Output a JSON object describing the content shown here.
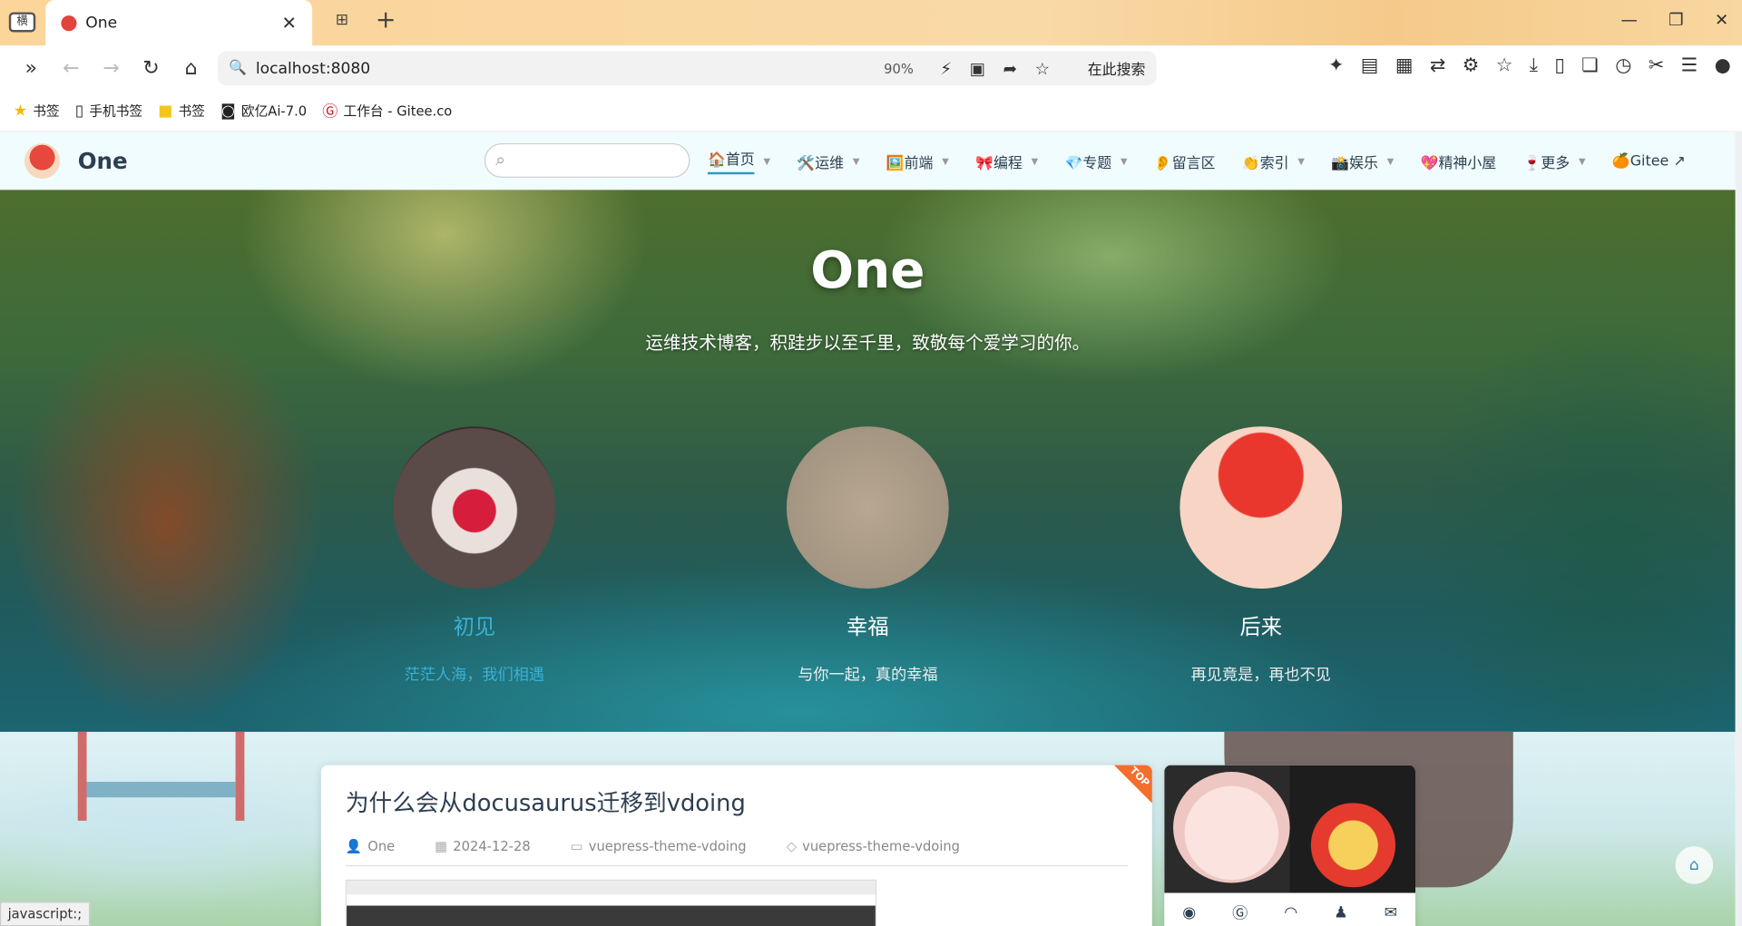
{
  "browser": {
    "tab_side": "横",
    "tab_title": "One",
    "url": "localhost:8080",
    "zoom": "90%",
    "search_placeholder": "在此搜索",
    "bookmarks": [
      {
        "label": "书签",
        "icon": "star-icon"
      },
      {
        "label": "手机书签",
        "icon": "phone-icon"
      },
      {
        "label": "书签",
        "icon": "folder-icon"
      },
      {
        "label": "欧亿Ai-7.0",
        "icon": "bot-icon"
      },
      {
        "label": "工作台 - Gitee.co",
        "icon": "gitee-icon"
      }
    ],
    "status_text": "javascript:;"
  },
  "site": {
    "name": "One",
    "nav": [
      {
        "label": "🏠首页",
        "caret": true,
        "active": true
      },
      {
        "label": "🛠️运维",
        "caret": true
      },
      {
        "label": "🖼️前端",
        "caret": true
      },
      {
        "label": "🎀编程",
        "caret": true
      },
      {
        "label": "💎专题",
        "caret": true
      },
      {
        "label": "👂留言区",
        "caret": false
      },
      {
        "label": "👏索引",
        "caret": true
      },
      {
        "label": "📸娱乐",
        "caret": true
      },
      {
        "label": "💖精神小屋",
        "caret": false
      },
      {
        "label": "🍷更多",
        "caret": true
      },
      {
        "label": "🍊Gitee ↗",
        "caret": false
      }
    ]
  },
  "hero": {
    "title": "One",
    "subtitle": "运维技术博客，积跬步以至千里，致敬每个爱学习的你。",
    "features": [
      {
        "title": "初见",
        "desc": "茫茫人海，我们相遇"
      },
      {
        "title": "幸福",
        "desc": "与你一起，真的幸福"
      },
      {
        "title": "后来",
        "desc": "再见竟是，再也不见"
      }
    ]
  },
  "post": {
    "badge": "TOP",
    "title": "为什么会从docusaurus迁移到vdoing",
    "author": "One",
    "date": "2024-12-28",
    "category": "vuepress-theme-vdoing",
    "tag": "vuepress-theme-vdoing"
  },
  "colors": {
    "accent": "#3ab1d6",
    "nav_text": "#2c3e50",
    "badge": "#f46e2e"
  }
}
